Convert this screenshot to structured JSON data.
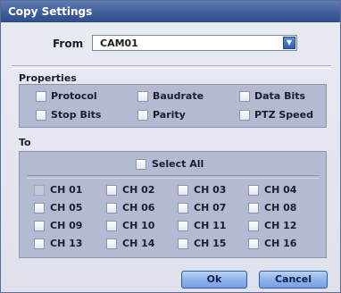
{
  "window": {
    "title": "Copy Settings"
  },
  "from": {
    "label": "From",
    "value": "CAM01"
  },
  "properties": {
    "label": "Properties",
    "items": [
      {
        "label": "Protocol",
        "checked": false
      },
      {
        "label": "Baudrate",
        "checked": false
      },
      {
        "label": "Data Bits",
        "checked": false
      },
      {
        "label": "Stop Bits",
        "checked": false
      },
      {
        "label": "Parity",
        "checked": false
      },
      {
        "label": "PTZ Speed",
        "checked": false
      }
    ]
  },
  "to": {
    "label": "To",
    "select_all": "Select All",
    "channels": [
      {
        "label": "CH 01",
        "disabled": true
      },
      {
        "label": "CH 02"
      },
      {
        "label": "CH 03"
      },
      {
        "label": "CH 04"
      },
      {
        "label": "CH 05"
      },
      {
        "label": "CH 06"
      },
      {
        "label": "CH 07"
      },
      {
        "label": "CH 08"
      },
      {
        "label": "CH 09"
      },
      {
        "label": "CH 10"
      },
      {
        "label": "CH 11"
      },
      {
        "label": "CH 12"
      },
      {
        "label": "CH 13"
      },
      {
        "label": "CH 14"
      },
      {
        "label": "CH 15"
      },
      {
        "label": "CH 16"
      }
    ]
  },
  "buttons": {
    "ok": "Ok",
    "cancel": "Cancel"
  }
}
